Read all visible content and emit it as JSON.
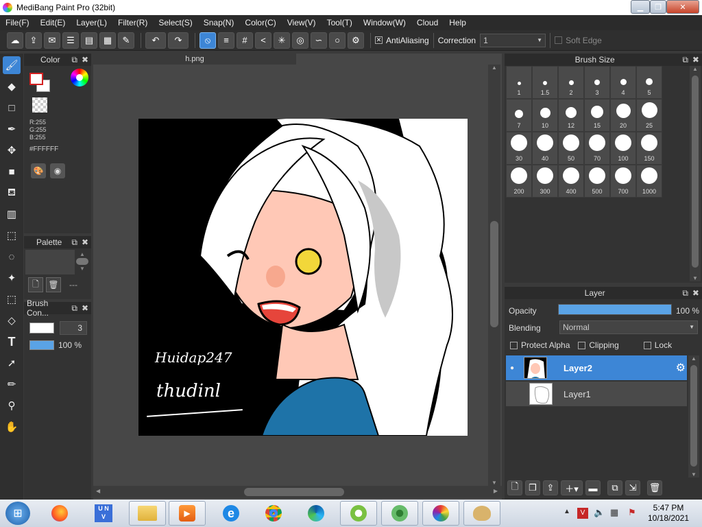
{
  "window": {
    "title": "MediBang Paint Pro (32bit)"
  },
  "menu": [
    "File(F)",
    "Edit(E)",
    "Layer(L)",
    "Filter(R)",
    "Select(S)",
    "Snap(N)",
    "Color(C)",
    "View(V)",
    "Tool(T)",
    "Window(W)",
    "Cloud",
    "Help"
  ],
  "toolbar": {
    "antialiasing_label": "AntiAliasing",
    "correction_label": "Correction",
    "correction_value": "1",
    "softedge_label": "Soft Edge"
  },
  "color_panel": {
    "title": "Color",
    "r": "R:255",
    "g": "G:255",
    "b": "B:255",
    "hex": "#FFFFFF",
    "foreground": "#ffffff",
    "background_outline": "#d42020"
  },
  "palette_panel": {
    "title": "Palette",
    "dashes": "---"
  },
  "brush_control_panel": {
    "title": "Brush Con...",
    "size": "3",
    "opacity": "100 %"
  },
  "document": {
    "tab": "h.png"
  },
  "artwork": {
    "signature1": "Huidap247",
    "signature2": "thudinl"
  },
  "brush_size_panel": {
    "title": "Brush Size",
    "sizes": [
      "1",
      "1.5",
      "2",
      "3",
      "4",
      "5",
      "7",
      "10",
      "12",
      "15",
      "20",
      "25",
      "30",
      "40",
      "50",
      "70",
      "100",
      "150",
      "200",
      "300",
      "400",
      "500",
      "700",
      "1000"
    ]
  },
  "layer_panel": {
    "title": "Layer",
    "opacity_label": "Opacity",
    "opacity_value": "100 %",
    "opacity_fraction": 1.0,
    "blending_label": "Blending",
    "blending_value": "Normal",
    "protect_alpha": "Protect Alpha",
    "clipping": "Clipping",
    "lock": "Lock",
    "layers": [
      {
        "name": "Layer2",
        "selected": true
      },
      {
        "name": "Layer1",
        "selected": false
      }
    ]
  },
  "taskbar": {
    "time": "5:47 PM",
    "date": "10/18/2021",
    "apps": [
      "start",
      "firefox",
      "unikey",
      "file-explorer",
      "media-player",
      "internet-explorer",
      "chrome",
      "edge",
      "coccoc",
      "browser-green",
      "medibang",
      "paint"
    ]
  },
  "colors": {
    "accent": "#3d86d6",
    "panel": "#333333",
    "canvas_bg": "#474747"
  }
}
